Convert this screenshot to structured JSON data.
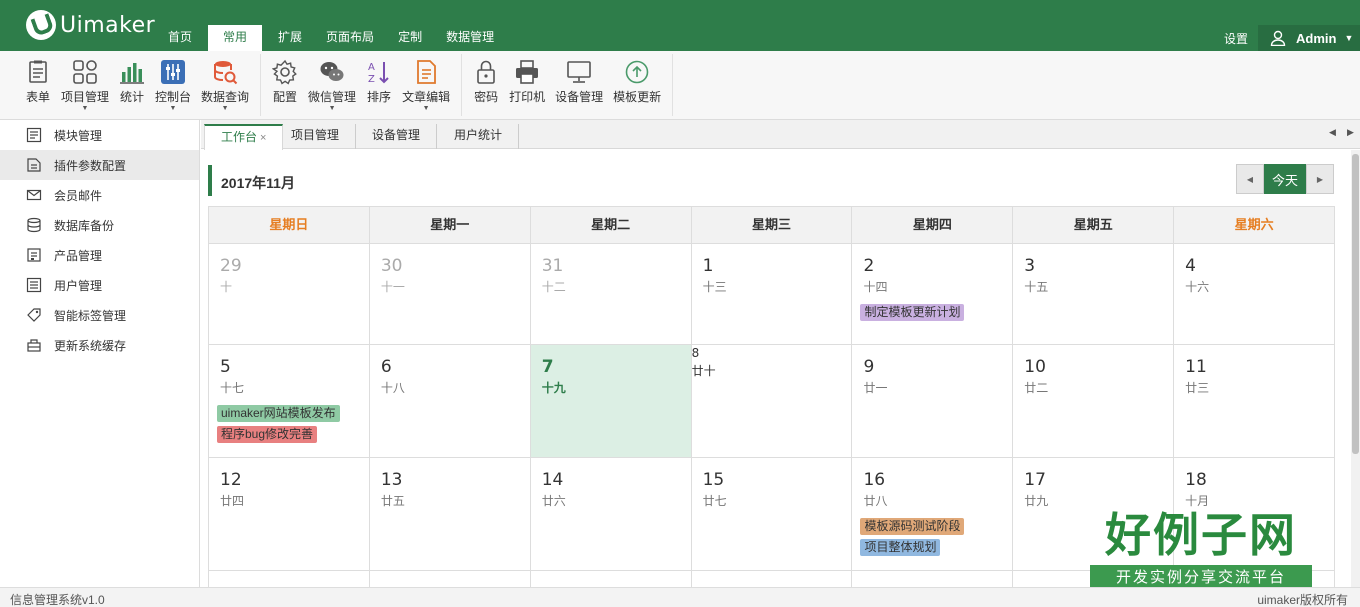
{
  "app": {
    "logo_text": "Uimaker",
    "settings_label": "设置",
    "user_name": "Admin"
  },
  "nav": {
    "items": [
      "首页",
      "常用",
      "扩展",
      "页面布局",
      "定制",
      "数据管理"
    ],
    "active_index": 1
  },
  "toolbar": {
    "groups": [
      [
        {
          "label": "表单",
          "icon": "form-icon",
          "dropdown": false
        },
        {
          "label": "项目管理",
          "icon": "grid-icon",
          "dropdown": true
        },
        {
          "label": "统计",
          "icon": "bar-chart-icon",
          "dropdown": false
        },
        {
          "label": "控制台",
          "icon": "sliders-icon",
          "dropdown": true
        },
        {
          "label": "数据查询",
          "icon": "database-search-icon",
          "dropdown": true
        }
      ],
      [
        {
          "label": "配置",
          "icon": "gear-icon",
          "dropdown": false
        },
        {
          "label": "微信管理",
          "icon": "wechat-icon",
          "dropdown": true
        },
        {
          "label": "排序",
          "icon": "sort-az-icon",
          "dropdown": false
        },
        {
          "label": "文章编辑",
          "icon": "document-edit-icon",
          "dropdown": true
        }
      ],
      [
        {
          "label": "密码",
          "icon": "lock-icon",
          "dropdown": false
        },
        {
          "label": "打印机",
          "icon": "printer-icon",
          "dropdown": false
        },
        {
          "label": "设备管理",
          "icon": "monitor-icon",
          "dropdown": false
        },
        {
          "label": "模板更新",
          "icon": "upload-circle-icon",
          "dropdown": false
        }
      ]
    ]
  },
  "sidebar": {
    "items": [
      {
        "label": "模块管理",
        "icon": "module-icon"
      },
      {
        "label": "插件参数配置",
        "icon": "plugin-icon",
        "active": true
      },
      {
        "label": "会员邮件",
        "icon": "mail-icon"
      },
      {
        "label": "数据库备份",
        "icon": "database-icon"
      },
      {
        "label": "产品管理",
        "icon": "product-icon"
      },
      {
        "label": "用户管理",
        "icon": "users-icon"
      },
      {
        "label": "智能标签管理",
        "icon": "tag-icon"
      },
      {
        "label": "更新系统缓存",
        "icon": "cache-icon"
      }
    ]
  },
  "tabs": {
    "items": [
      "工作台",
      "项目管理",
      "设备管理",
      "用户统计"
    ],
    "close_glyph": "×"
  },
  "calendar": {
    "title": "2017年11月",
    "today_label": "今天",
    "weekdays": [
      "星期日",
      "星期一",
      "星期二",
      "星期三",
      "星期四",
      "星期五",
      "星期六"
    ],
    "weeks": [
      [
        {
          "day": "29",
          "lunar": "十",
          "other": true
        },
        {
          "day": "30",
          "lunar": "十一",
          "other": true
        },
        {
          "day": "31",
          "lunar": "十二",
          "other": true
        },
        {
          "day": "1",
          "lunar": "十三"
        },
        {
          "day": "2",
          "lunar": "十四",
          "events": [
            {
              "text": "制定模板更新计划",
              "color": "#c9b0e0"
            }
          ]
        },
        {
          "day": "3",
          "lunar": "十五"
        },
        {
          "day": "4",
          "lunar": "十六"
        }
      ],
      [
        {
          "day": "5",
          "lunar": "十七",
          "events": [
            {
              "text": "uimaker网站模板发布",
              "color": "#8fcaa4"
            },
            {
              "text": "程序bug修改完善",
              "color": "#e88080"
            }
          ]
        },
        {
          "day": "6",
          "lunar": "十八"
        },
        {
          "day": "7",
          "lunar": "十九",
          "today": true
        },
        {
          "day": "8",
          "lunar": "廿十",
          "small": true
        },
        {
          "day": "9",
          "lunar": "廿一"
        },
        {
          "day": "10",
          "lunar": "廿二"
        },
        {
          "day": "11",
          "lunar": "廿三"
        }
      ],
      [
        {
          "day": "12",
          "lunar": "廿四"
        },
        {
          "day": "13",
          "lunar": "廿五"
        },
        {
          "day": "14",
          "lunar": "廿六"
        },
        {
          "day": "15",
          "lunar": "廿七"
        },
        {
          "day": "16",
          "lunar": "廿八",
          "events": [
            {
              "text": "模板源码测试阶段",
              "color": "#e0a878"
            },
            {
              "text": "项目整体规划",
              "color": "#90b8e0"
            }
          ]
        },
        {
          "day": "17",
          "lunar": "廿九"
        },
        {
          "day": "18",
          "lunar": "十月"
        }
      ]
    ]
  },
  "footer": {
    "left": "信息管理系统v1.0",
    "right": "uimaker版权所有"
  },
  "watermark": {
    "title": "好例子网",
    "subtitle": "开发实例分享交流平台"
  },
  "colors": {
    "brand": "#2e7d4a",
    "weekend": "#e67e22",
    "today_bg": "#dcefe4"
  }
}
